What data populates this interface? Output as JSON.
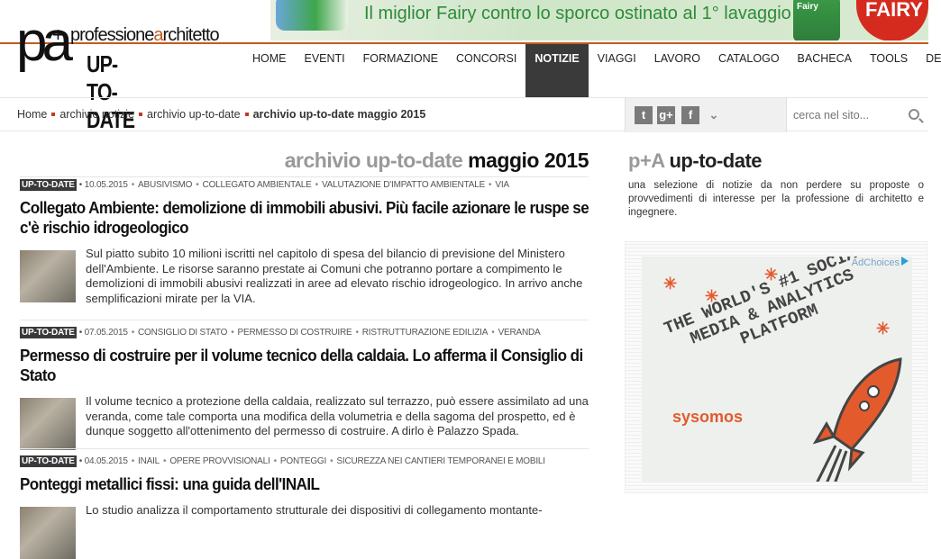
{
  "ad_banner": {
    "slogan": "Il miglior Fairy contro lo sporco ostinato al 1° lavaggio",
    "brand": "FAIRY",
    "bottle_label": "Fairy"
  },
  "logo": {
    "mark": "pa",
    "plus": "+",
    "name_part1": "professione",
    "name_part2": "a",
    "name_part3": "rchitetto",
    "subtitle": "UP-TO-DATE"
  },
  "nav": {
    "items": [
      "HOME",
      "EVENTI",
      "FORMAZIONE",
      "CONCORSI",
      "NOTIZIE",
      "VIAGGI",
      "LAVORO",
      "CATALOGO",
      "BACHECA",
      "TOOLS",
      "DESIGN"
    ],
    "active": "NOTIZIE"
  },
  "breadcrumb": {
    "items": [
      "Home",
      "archivio notizie",
      "archivio up-to-date"
    ],
    "current": "archivio up-to-date maggio 2015"
  },
  "social": {
    "icons": [
      "twitter-icon",
      "google-plus-icon",
      "facebook-icon",
      "chevron-down-icon"
    ]
  },
  "search": {
    "placeholder": "cerca nel sito..."
  },
  "page_title": {
    "part1": "archivio up-to-date",
    "part2": "maggio 2015"
  },
  "articles": [
    {
      "badge": "UP-TO-DATE",
      "date": "10.05.2015",
      "tags": [
        "ABUSIVISMO",
        "COLLEGATO AMBIENTALE",
        "VALUTAZIONE D'IMPATTO AMBIENTALE",
        "VIA"
      ],
      "title": "Collegato Ambiente: demolizione di immobili abusivi. Più facile azionare le ruspe se c'è rischio idrogeologico",
      "summary": "Sul piatto subito 10 milioni iscritti nel capitolo di spesa del bilancio di previsione del Ministero dell'Ambiente. Le risorse saranno prestate ai Comuni che potranno portare a compimento le demolizioni di immobili abusivi realizzati in aree ad elevato rischio idrogeologico. In arrivo anche semplificazioni mirate per la VIA."
    },
    {
      "badge": "UP-TO-DATE",
      "date": "07.05.2015",
      "tags": [
        "CONSIGLIO DI STATO",
        "PERMESSO DI COSTRUIRE",
        "RISTRUTTURAZIONE EDILIZIA",
        "VERANDA"
      ],
      "title": "Permesso di costruire per il volume tecnico della caldaia. Lo afferma il Consiglio di Stato",
      "summary": "Il volume tecnico a protezione della caldaia, realizzato sul terrazzo, può essere assimilato ad una veranda, come tale comporta una modifica della volumetria e della sagoma del prospetto, ed è dunque soggetto all'ottenimento del permesso di costruire. A dirlo è Palazzo Spada."
    },
    {
      "badge": "UP-TO-DATE",
      "date": "04.05.2015",
      "tags": [
        "INAIL",
        "OPERE PROVVISIONALI",
        "PONTEGGI",
        "SICUREZZA NEI CANTIERI TEMPORANEI E MOBILI"
      ],
      "title": "Ponteggi metallici fissi: una guida dell'INAIL",
      "summary": "Lo studio analizza il comportamento strutturale dei dispositivi di collegamento montante-"
    }
  ],
  "sidebar": {
    "title_part1": "p+A",
    "title_part2": "up-to-date",
    "description": "una selezione di notizie da non perdere su proposte o provvedimenti di interesse per la professione di architetto e ingegnere."
  },
  "side_ad": {
    "adchoices": "AdChoices",
    "headline_lines": [
      "THE WORLD'S #1 SOCIAL",
      "MEDIA & ANALYTICS",
      "PLATFORM"
    ],
    "brand": "sysomos"
  },
  "colors": {
    "accent": "#c45a1e",
    "active_nav": "#3a3a3a",
    "ad_orange": "#e35a2c"
  }
}
